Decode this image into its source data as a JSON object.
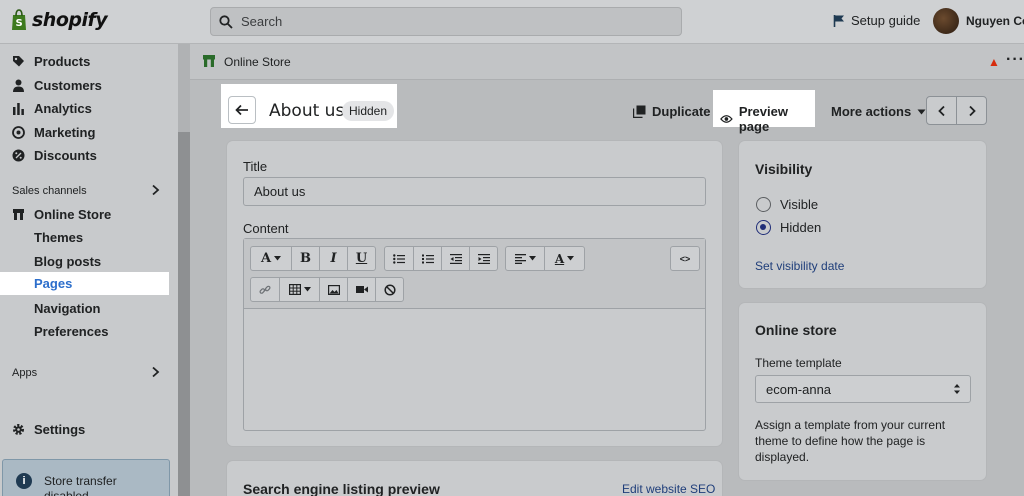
{
  "topbar": {
    "logo_text": "shopify",
    "search_placeholder": "Search",
    "setup_guide": "Setup guide",
    "user_name": "Nguyen Co"
  },
  "sidebar": {
    "items": [
      {
        "label": "Products",
        "icon": "tag-icon"
      },
      {
        "label": "Customers",
        "icon": "person-icon"
      },
      {
        "label": "Analytics",
        "icon": "bar-chart-icon"
      },
      {
        "label": "Marketing",
        "icon": "target-icon"
      },
      {
        "label": "Discounts",
        "icon": "discount-icon"
      }
    ],
    "sales_channels_label": "Sales channels",
    "online_store": "Online Store",
    "sub_items": [
      "Themes",
      "Blog posts",
      "Pages",
      "Navigation",
      "Preferences"
    ],
    "active_sub": "Pages",
    "apps_label": "Apps",
    "settings": "Settings",
    "transfer_text": "Store transfer disabled"
  },
  "store_header": {
    "title": "Online Store"
  },
  "page": {
    "title": "About us",
    "badge": "Hidden",
    "duplicate": "Duplicate",
    "preview": "Preview page",
    "more_actions": "More actions"
  },
  "main_card": {
    "title_label": "Title",
    "title_value": "About us",
    "content_label": "Content",
    "toolbar": {
      "font": "A",
      "bold": "B",
      "italic": "I",
      "underline": "U",
      "color": "A",
      "html": "<>"
    }
  },
  "seo_card": {
    "title": "Search engine listing preview",
    "edit_link": "Edit website SEO"
  },
  "visibility_card": {
    "title": "Visibility",
    "options": [
      "Visible",
      "Hidden"
    ],
    "selected": "Hidden",
    "set_date": "Set visibility date"
  },
  "online_store_card": {
    "title": "Online store",
    "template_label": "Theme template",
    "template_value": "ecom-anna",
    "help": "Assign a template from your current theme to define how the page is displayed."
  },
  "colors": {
    "accent": "#2c6ecb",
    "radio": "#202e78",
    "pin": "#d72c0d"
  }
}
